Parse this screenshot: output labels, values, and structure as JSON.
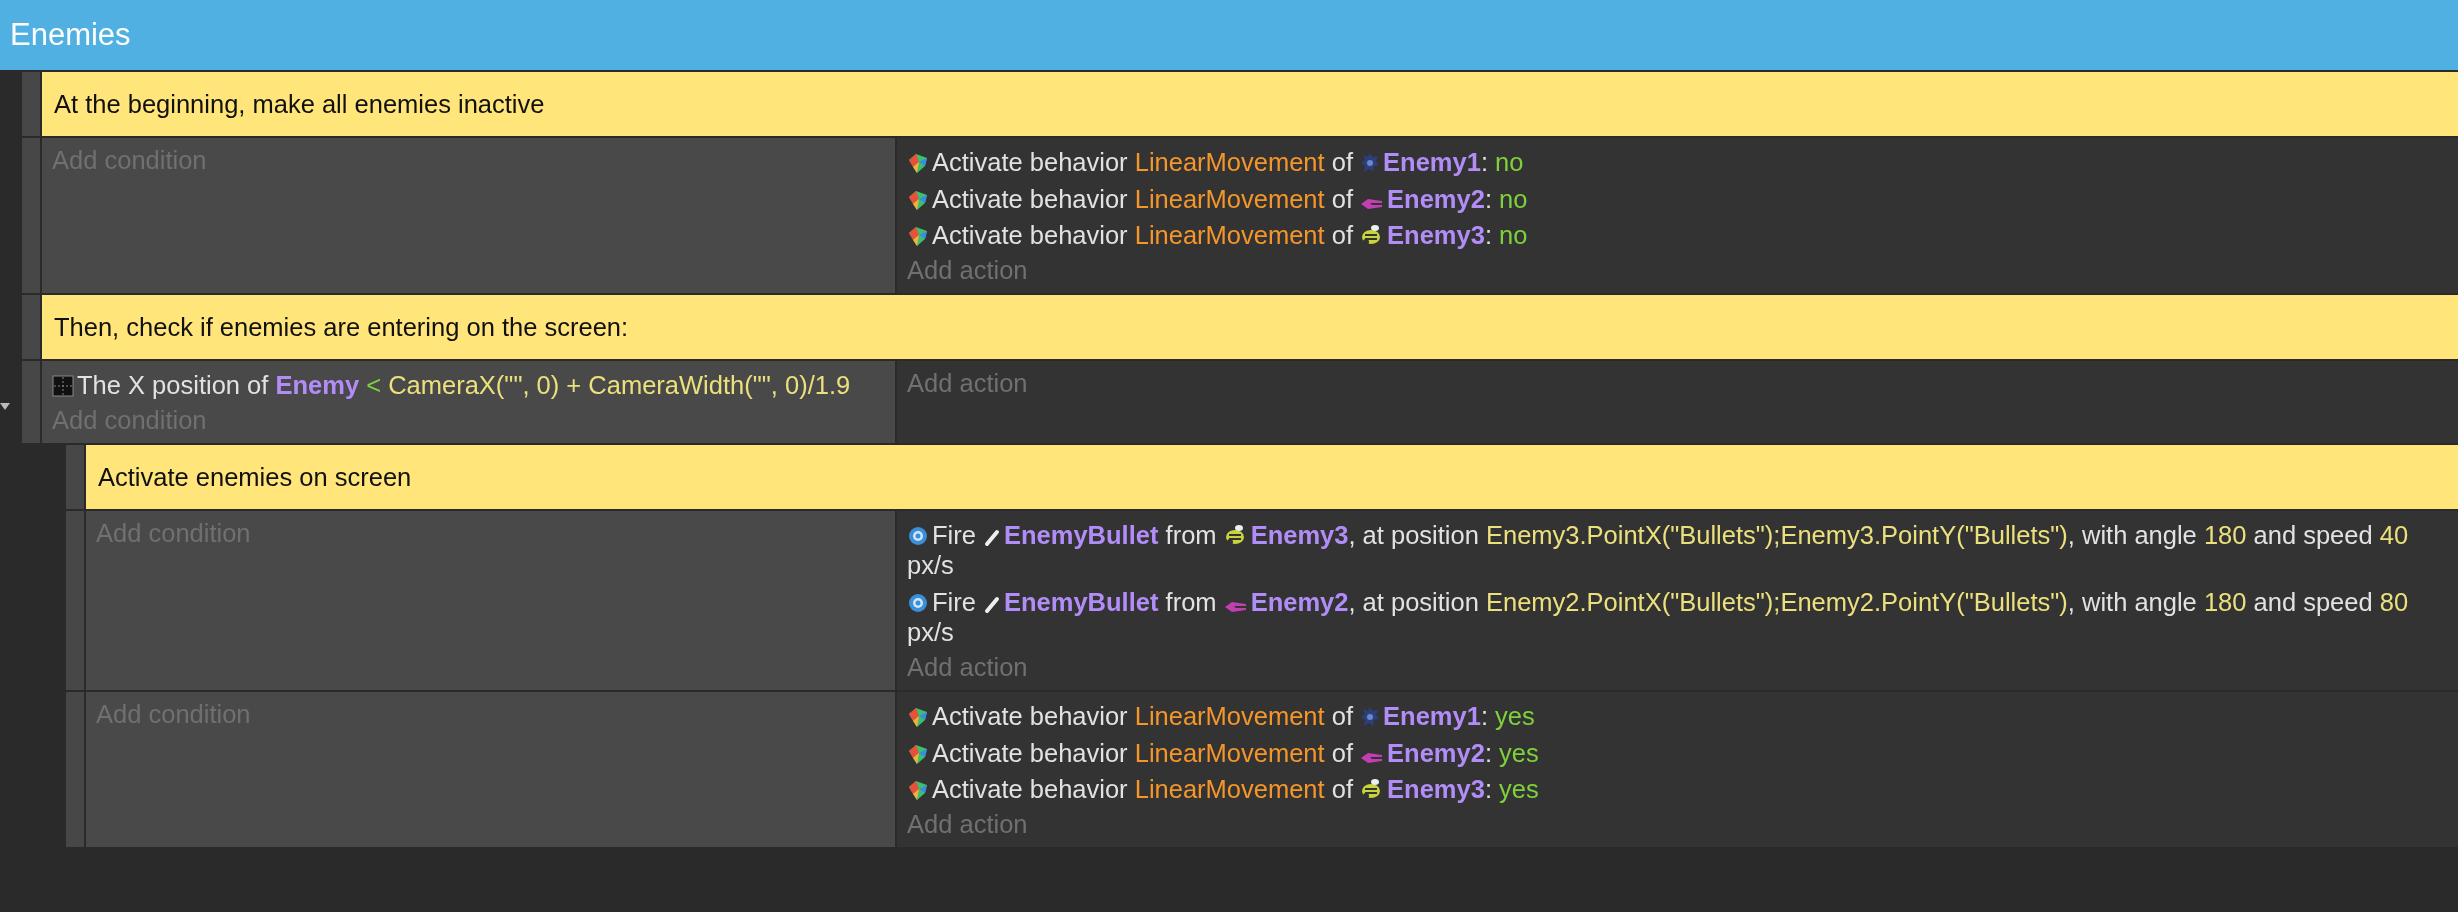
{
  "title": "Enemies",
  "events": [
    {
      "kind": "comment",
      "text": "At the beginning, make all enemies inactive"
    },
    {
      "kind": "standard",
      "add_condition": "Add condition",
      "add_action": "Add action",
      "actions": [
        {
          "kind": "behavior",
          "parts": [
            {
              "kind": "text",
              "text": "Activate behavior "
            },
            {
              "kind": "behavior",
              "text": "LinearMovement"
            },
            {
              "kind": "text",
              "text": " of "
            },
            {
              "kind": "spiky"
            },
            {
              "kind": "object",
              "text": "Enemy1"
            },
            {
              "kind": "text",
              "text": ": "
            },
            {
              "kind": "bool",
              "text": "no"
            }
          ]
        },
        {
          "kind": "behavior",
          "parts": [
            {
              "kind": "text",
              "text": "Activate behavior "
            },
            {
              "kind": "behavior",
              "text": "LinearMovement"
            },
            {
              "kind": "text",
              "text": " of "
            },
            {
              "kind": "ship"
            },
            {
              "kind": "object",
              "text": "Enemy2"
            },
            {
              "kind": "text",
              "text": ": "
            },
            {
              "kind": "bool",
              "text": "no"
            }
          ]
        },
        {
          "kind": "behavior",
          "parts": [
            {
              "kind": "text",
              "text": "Activate behavior "
            },
            {
              "kind": "behavior",
              "text": "LinearMovement"
            },
            {
              "kind": "text",
              "text": " of "
            },
            {
              "kind": "bee"
            },
            {
              "kind": "object",
              "text": "Enemy3"
            },
            {
              "kind": "text",
              "text": ": "
            },
            {
              "kind": "bool",
              "text": "no"
            }
          ]
        }
      ]
    },
    {
      "kind": "comment",
      "text": "Then, check if enemies are entering on the screen:"
    },
    {
      "kind": "standard",
      "expanded": true,
      "add_condition": "Add condition",
      "add_action": "Add action",
      "conditions": [
        {
          "kind": "position",
          "parts": [
            {
              "kind": "text",
              "text": "The X position of "
            },
            {
              "kind": "object",
              "text": "Enemy"
            },
            {
              "kind": "operator",
              "text": " < "
            },
            {
              "kind": "value",
              "text": "CameraX(\"\", 0) + CameraWidth(\"\", 0)/1.9"
            }
          ]
        }
      ],
      "children": [
        {
          "kind": "comment",
          "text": "Activate enemies on screen"
        },
        {
          "kind": "standard",
          "add_condition": "Add condition",
          "add_action": "Add action",
          "actions": [
            {
              "kind": "fire",
              "parts": [
                {
                  "kind": "text",
                  "text": "Fire "
                },
                {
                  "kind": "bullet"
                },
                {
                  "kind": "object",
                  "text": "EnemyBullet"
                },
                {
                  "kind": "text",
                  "text": " from "
                },
                {
                  "kind": "bee"
                },
                {
                  "kind": "object",
                  "text": "Enemy3"
                },
                {
                  "kind": "text",
                  "text": ", at position "
                },
                {
                  "kind": "value",
                  "text": "Enemy3.PointX(\"Bullets\");Enemy3.PointY(\"Bullets\")"
                },
                {
                  "kind": "text",
                  "text": ", with angle "
                },
                {
                  "kind": "value",
                  "text": "180"
                },
                {
                  "kind": "text",
                  "text": " and speed "
                },
                {
                  "kind": "value",
                  "text": "40"
                },
                {
                  "kind": "text",
                  "text": " px/s"
                }
              ]
            },
            {
              "kind": "fire",
              "parts": [
                {
                  "kind": "text",
                  "text": "Fire "
                },
                {
                  "kind": "bullet"
                },
                {
                  "kind": "object",
                  "text": "EnemyBullet"
                },
                {
                  "kind": "text",
                  "text": " from "
                },
                {
                  "kind": "ship"
                },
                {
                  "kind": "object",
                  "text": "Enemy2"
                },
                {
                  "kind": "text",
                  "text": ", at position "
                },
                {
                  "kind": "value",
                  "text": "Enemy2.PointX(\"Bullets\");Enemy2.PointY(\"Bullets\")"
                },
                {
                  "kind": "text",
                  "text": ", with angle "
                },
                {
                  "kind": "value",
                  "text": "180"
                },
                {
                  "kind": "text",
                  "text": " and speed "
                },
                {
                  "kind": "value",
                  "text": "80"
                },
                {
                  "kind": "text",
                  "text": " px/s"
                }
              ]
            }
          ]
        },
        {
          "kind": "standard",
          "add_condition": "Add condition",
          "add_action": "Add action",
          "actions": [
            {
              "kind": "behavior",
              "parts": [
                {
                  "kind": "text",
                  "text": "Activate behavior "
                },
                {
                  "kind": "behavior",
                  "text": "LinearMovement"
                },
                {
                  "kind": "text",
                  "text": " of "
                },
                {
                  "kind": "spiky"
                },
                {
                  "kind": "object",
                  "text": "Enemy1"
                },
                {
                  "kind": "text",
                  "text": ": "
                },
                {
                  "kind": "bool",
                  "text": "yes"
                }
              ]
            },
            {
              "kind": "behavior",
              "parts": [
                {
                  "kind": "text",
                  "text": "Activate behavior "
                },
                {
                  "kind": "behavior",
                  "text": "LinearMovement"
                },
                {
                  "kind": "text",
                  "text": " of "
                },
                {
                  "kind": "ship"
                },
                {
                  "kind": "object",
                  "text": "Enemy2"
                },
                {
                  "kind": "text",
                  "text": ": "
                },
                {
                  "kind": "bool",
                  "text": "yes"
                }
              ]
            },
            {
              "kind": "behavior",
              "parts": [
                {
                  "kind": "text",
                  "text": "Activate behavior "
                },
                {
                  "kind": "behavior",
                  "text": "LinearMovement"
                },
                {
                  "kind": "text",
                  "text": " of "
                },
                {
                  "kind": "bee"
                },
                {
                  "kind": "object",
                  "text": "Enemy3"
                },
                {
                  "kind": "text",
                  "text": ": "
                },
                {
                  "kind": "bool",
                  "text": "yes"
                }
              ]
            }
          ]
        }
      ]
    }
  ]
}
